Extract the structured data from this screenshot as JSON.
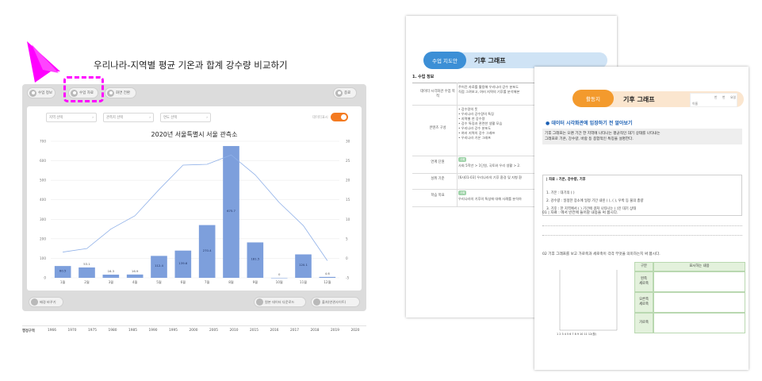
{
  "app": {
    "title": "우리나라-지역별 평균 기온과 합계 강수량 비교하기",
    "topbar": {
      "lesson_info": "수업 정보",
      "lesson_material": "수업 자료",
      "screen_switch": "화면 전환",
      "exit": "종료"
    },
    "filters": {
      "region": "지역 선택",
      "station": "관측지 선택",
      "year": "연도 선택",
      "data_label": "데이터표시"
    },
    "chart_title": "2020년 서울특별시 서울 관측소",
    "bottombar": {
      "change_background": "배경 바꾸기",
      "download": "원본 데이터 다운로드",
      "source": "출처(연관사이트)"
    },
    "year_strip": {
      "label": "행정구역",
      "years": [
        "1966",
        "1970",
        "1975",
        "1980",
        "1985",
        "1990",
        "1995",
        "2000",
        "2005",
        "2010",
        "2015",
        "2016",
        "2017",
        "2018",
        "2019",
        "2020"
      ]
    },
    "colors": {
      "highlight": "#ff00ff",
      "toggle": "#f47a20",
      "bar": "#7d9fdc",
      "line": "#8fb0e8"
    }
  },
  "chart_data": {
    "type": "bar",
    "title": "2020년 서울특별시 서울 관측소",
    "categories": [
      "1월",
      "2월",
      "3월",
      "4월",
      "5월",
      "6월",
      "7월",
      "8월",
      "9월",
      "10월",
      "11월",
      "12월"
    ],
    "series": [
      {
        "type": "bar",
        "axis": "left",
        "values": [
          60.5,
          53.1,
          16.3,
          16.9,
          112.4,
          139.6,
          270.4,
          675.7,
          181.5,
          0,
          120.1,
          4.6
        ],
        "labels": [
          "60.5",
          "53.1",
          "16.3",
          "16.9",
          "112.4",
          "139.6",
          "270.4",
          "675.7",
          "181.5",
          "0",
          "120.1",
          "4.6"
        ]
      },
      {
        "type": "line",
        "axis": "right",
        "values": [
          1.6,
          2.5,
          7.5,
          10.9,
          17.6,
          23.9,
          24.1,
          26.5,
          21.4,
          14.3,
          8.4,
          -0.6
        ]
      }
    ],
    "y_left": {
      "min": 0,
      "max": 700,
      "ticks": [
        "0",
        "100",
        "200",
        "300",
        "400",
        "500",
        "600",
        "700"
      ]
    },
    "y_right": {
      "min": -5,
      "max": 30,
      "ticks": [
        "-5",
        "0",
        "5",
        "10",
        "15",
        "20",
        "25",
        "30"
      ]
    },
    "grid": true
  },
  "doc1": {
    "tag": "수업 지도안",
    "title": "기후 그래프",
    "section": "1. 수업 정보",
    "rows": [
      {
        "label": "데이터 시각화관 수업 목적",
        "text": "주어진 자료를 활용해 우리나라 강수 분포도\n직접 그려보고, 여러 지역의 기후를 분석해본"
      },
      {
        "label": "콘텐츠 구성",
        "text": "• 강수량의 뜻\n• 우리나라 강수량의 특징\n• 지역별 연 강수량\n• 강수 특징과 관련한 생활 모습\n• 우리나라 강수 분포도\n• 여러 지역의 강수 그래프\n• 우리나라 기온 그래프"
      },
      {
        "label": "연계 단원",
        "badge": "사회",
        "text": "사회 5학년 > 1단원, 국토와 우리 생활 > 2."
      },
      {
        "label": "성취 기준",
        "text": "[6사01-03] 우리나라의 기후 환경 및 지형 환"
      },
      {
        "label": "학습 목표",
        "badge": "사회",
        "text": "우리나라의 기후의 특성에 대해 사례를 분석하"
      }
    ]
  },
  "doc2": {
    "tag": "활동지",
    "title": "기후 그래프",
    "header_fields": {
      "grade": "반",
      "num": "번",
      "date": "요일",
      "name": "이름"
    },
    "q_intro": "데이터 시각화관에 입장하기 전 알아보기",
    "intro_text": "기후 그래프는 오랜 기간 한 지역에 나타나는 평균적인 대기 상태를 나타내는\n그래프로 기온, 강수량, 바람 등 종합적인 특징을 설명한다.",
    "data_box_title": "| 자료 : 기온, 강수량, 기후",
    "items": [
      "1. 기온 : 대기의 (        )",
      "2. 강수량 : 일정한 장소에 일정 기간 내린 (        ), (        ), 우박 등 물의 총량",
      "3. 기후 : 한 지역에서 (        ) 기간에 걸쳐 나타나는 (        )인 대기 상태"
    ],
    "q01": "01 | 자료 : 에서 빈칸에 들어갈 내용을 써 봅시다.",
    "q02": "02 기후 그래프를 보고 가로축과 세로축이 각각 무엇을 의미하는지 써 봅시다.",
    "table": {
      "headers": [
        "구분",
        "표시하는 내용"
      ],
      "rows": [
        "왼쪽\n세로축",
        "오른쪽\n세로축",
        "가로축"
      ]
    },
    "mini_axis": "1 2 3 4 5 6 7 8 9 10 11 12(월)"
  }
}
